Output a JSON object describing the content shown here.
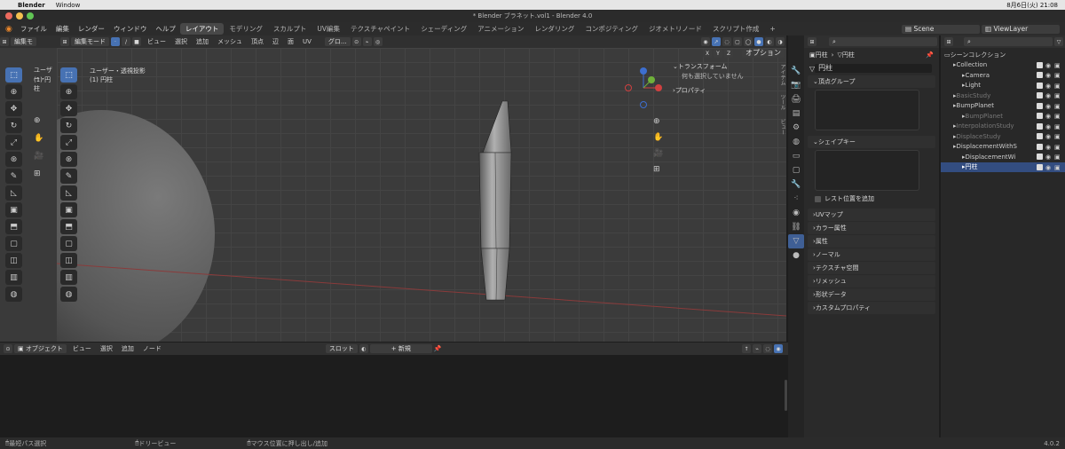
{
  "mac_menu": {
    "app": "Blender",
    "window": "Window",
    "datetime": "8月6日(火) 21:08"
  },
  "window_title": "* Blender ブラネット.vol1 - Blender 4.0",
  "main_menu": [
    "ファイル",
    "編集",
    "レンダー",
    "ウィンドウ",
    "ヘルプ"
  ],
  "workspace_tabs": [
    "レイアウト",
    "モデリング",
    "スカルプト",
    "UV編集",
    "テクスチャペイント",
    "シェーディング",
    "アニメーション",
    "レンダリング",
    "コンポジティング",
    "ジオメトリノード",
    "スクリプト作成"
  ],
  "active_tab": "レイアウト",
  "scene": {
    "label": "Scene",
    "viewlayer": "ViewLayer"
  },
  "left_viewport": {
    "title": "ユーザー・",
    "object": "(1) 円柱",
    "mode": "編集モ"
  },
  "viewport": {
    "mode_label": "編集モード",
    "menus": [
      "ビュー",
      "選択",
      "追加",
      "メッシュ",
      "頂点",
      "辺",
      "面",
      "UV"
    ],
    "transform_orient": "グロ...",
    "view_title": "ユーザー・透視投影",
    "object_name": "(1) 円柱",
    "options_label": "オプション",
    "xyz": [
      "X",
      "Y",
      "Z"
    ]
  },
  "sidebar": {
    "transform_title": "トランスフォーム",
    "nothing_selected": "何も選択していません",
    "properties_title": "プロパティ",
    "tabs": [
      "アイテム",
      "ツール",
      "ビュー"
    ]
  },
  "properties": {
    "breadcrumb": [
      "円柱",
      "円柱"
    ],
    "mesh_name": "円柱",
    "vertex_groups": "頂点グループ",
    "shape_keys": "シェイプキー",
    "rest_position": "レスト位置を追加",
    "sections": [
      "UVマップ",
      "カラー属性",
      "属性",
      "ノーマル",
      "テクスチャ空間",
      "リメッシュ",
      "形状データ",
      "カスタムプロパティ"
    ]
  },
  "outliner": {
    "title": "シーンコレクション",
    "rows": [
      {
        "name": "Collection",
        "indent": 1,
        "dim": false,
        "sel": false
      },
      {
        "name": "Camera",
        "indent": 2,
        "dim": false,
        "sel": false
      },
      {
        "name": "Light",
        "indent": 2,
        "dim": false,
        "sel": false
      },
      {
        "name": "BasicStudy",
        "indent": 1,
        "dim": true,
        "sel": false
      },
      {
        "name": "BumpPlanet",
        "indent": 1,
        "dim": false,
        "sel": false
      },
      {
        "name": "BumpPlanet",
        "indent": 2,
        "dim": true,
        "sel": false
      },
      {
        "name": "InterpolationStudy",
        "indent": 1,
        "dim": true,
        "sel": false
      },
      {
        "name": "DisplaceStudy",
        "indent": 1,
        "dim": true,
        "sel": false
      },
      {
        "name": "DisplacementWithS",
        "indent": 1,
        "dim": false,
        "sel": false
      },
      {
        "name": "DisplacementWi",
        "indent": 2,
        "dim": false,
        "sel": false
      },
      {
        "name": "円柱",
        "indent": 2,
        "dim": false,
        "sel": true
      }
    ]
  },
  "timeline": {
    "mode": "オブジェクト",
    "menus": [
      "ビュー",
      "選択",
      "追加",
      "ノード"
    ],
    "slot": "スロット",
    "new_label": "新規"
  },
  "status": {
    "left": "最短パス選択",
    "mid": "ドリービュー",
    "right": "マウス位置に押し出し/追加",
    "version": "4.0.2"
  },
  "colors": {
    "accent": "#4772b3",
    "selected_row": "#334d80",
    "axis_x": "#b44a4a"
  }
}
